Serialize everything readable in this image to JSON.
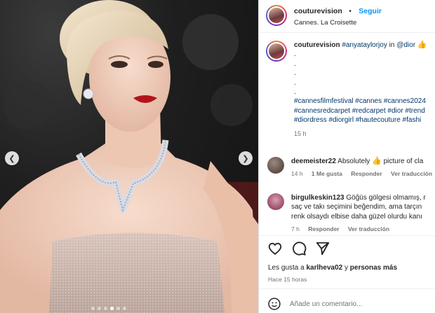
{
  "photo": {
    "prev_icon": "chevron-left-icon",
    "next_icon": "chevron-right-icon",
    "dot_count": 6,
    "active_dot": 3
  },
  "header": {
    "username": "couturevision",
    "separator": "•",
    "follow_label": "Seguir",
    "location": "Cannes. La Croisette"
  },
  "caption": {
    "username": "couturevision",
    "mention_actor": "#anyataylorjoy",
    "in_word": "in",
    "mention_brand": "@dior",
    "emoji": "👍",
    "dots": [
      ".",
      ".",
      ".",
      ".",
      "."
    ],
    "hashtags_line1": "#cannesfilmfestival #cannes #cannes2024",
    "hashtags_line2": "#cannesredcarpet #redcarpet #dior #trend",
    "hashtags_line3": "#diordress #diorgirl #hautecouture #fashi",
    "time": "15 h"
  },
  "comments": [
    {
      "username": "deemeister22",
      "text": "Absolutely",
      "emoji": "👍",
      "text_rest": "picture of cla",
      "time": "14 h",
      "likes": "1 Me gusta",
      "reply": "Responder",
      "see_translation": "Ver traducción"
    },
    {
      "username": "birgulkeskin123",
      "text_line1": "Göğüs gölgesi olmamış, r",
      "text_line2": "saç ve takı seçimini beğendim, ama tarçın",
      "text_line3": "renk olsaydı elbise daha güzel olurdu kanı",
      "time": "7 h",
      "reply": "Responder",
      "see_translation": "Ver traducción"
    }
  ],
  "actions": {
    "like_icon": "heart-icon",
    "comment_icon": "comment-icon",
    "share_icon": "send-icon"
  },
  "likes_text_prefix": "Les gusta a",
  "likes_user": "karlheva02",
  "likes_and": "y",
  "likes_others": "personas más",
  "posted_ago": "Hace 15 horas",
  "add_comment": {
    "emoji_icon": "smiley-icon",
    "placeholder": "Añade un comentario..."
  }
}
